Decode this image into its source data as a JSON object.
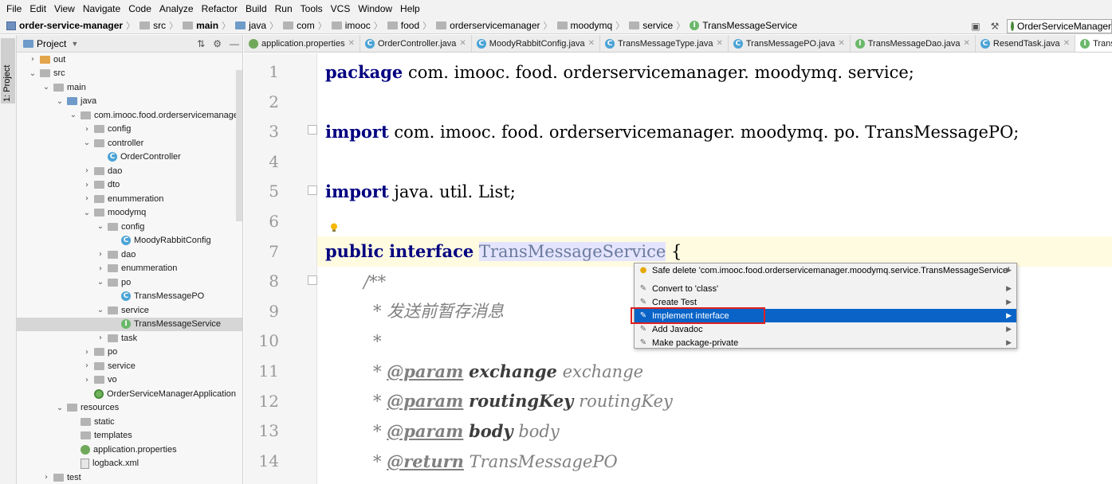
{
  "menu": [
    "File",
    "Edit",
    "View",
    "Navigate",
    "Code",
    "Analyze",
    "Refactor",
    "Build",
    "Run",
    "Tools",
    "VCS",
    "Window",
    "Help"
  ],
  "breadcrumb": [
    {
      "label": "order-service-manager",
      "icon": "module-icon",
      "bold": true
    },
    {
      "label": "src",
      "icon": "folder-icon",
      "bold": false
    },
    {
      "label": "main",
      "icon": "folder-icon",
      "bold": true
    },
    {
      "label": "java",
      "icon": "folder-icon",
      "bold": false
    },
    {
      "label": "com",
      "icon": "folder-icon",
      "bold": false
    },
    {
      "label": "imooc",
      "icon": "folder-icon",
      "bold": false
    },
    {
      "label": "food",
      "icon": "folder-icon",
      "bold": false
    },
    {
      "label": "orderservicemanager",
      "icon": "folder-icon",
      "bold": false
    },
    {
      "label": "moodymq",
      "icon": "folder-icon",
      "bold": false
    },
    {
      "label": "service",
      "icon": "folder-icon",
      "bold": false
    },
    {
      "label": "TransMessageService",
      "icon": "interface-icon",
      "bold": false
    }
  ],
  "run_config": "OrderServiceManagerA",
  "left_strip": {
    "project_tab": "1: Project"
  },
  "project_panel": {
    "title": "Project",
    "tree": [
      {
        "label": "out",
        "depth": 0,
        "arrow": "right",
        "icon": "folder-orange"
      },
      {
        "label": "src",
        "depth": 0,
        "arrow": "down",
        "icon": "folder"
      },
      {
        "label": "main",
        "depth": 1,
        "arrow": "down",
        "icon": "folder"
      },
      {
        "label": "java",
        "depth": 2,
        "arrow": "down",
        "icon": "folder-blue"
      },
      {
        "label": "com.imooc.food.orderservicemanager",
        "depth": 3,
        "arrow": "down",
        "icon": "folder"
      },
      {
        "label": "config",
        "depth": 4,
        "arrow": "right",
        "icon": "folder"
      },
      {
        "label": "controller",
        "depth": 4,
        "arrow": "down",
        "icon": "folder"
      },
      {
        "label": "OrderController",
        "depth": 5,
        "arrow": "none",
        "icon": "class"
      },
      {
        "label": "dao",
        "depth": 4,
        "arrow": "right",
        "icon": "folder"
      },
      {
        "label": "dto",
        "depth": 4,
        "arrow": "right",
        "icon": "folder"
      },
      {
        "label": "enummeration",
        "depth": 4,
        "arrow": "right",
        "icon": "folder"
      },
      {
        "label": "moodymq",
        "depth": 4,
        "arrow": "down",
        "icon": "folder"
      },
      {
        "label": "config",
        "depth": 5,
        "arrow": "down",
        "icon": "folder"
      },
      {
        "label": "MoodyRabbitConfig",
        "depth": 6,
        "arrow": "none",
        "icon": "class"
      },
      {
        "label": "dao",
        "depth": 5,
        "arrow": "right",
        "icon": "folder"
      },
      {
        "label": "enummeration",
        "depth": 5,
        "arrow": "right",
        "icon": "folder"
      },
      {
        "label": "po",
        "depth": 5,
        "arrow": "down",
        "icon": "folder"
      },
      {
        "label": "TransMessagePO",
        "depth": 6,
        "arrow": "none",
        "icon": "class"
      },
      {
        "label": "service",
        "depth": 5,
        "arrow": "down",
        "icon": "folder"
      },
      {
        "label": "TransMessageService",
        "depth": 6,
        "arrow": "none",
        "icon": "interface",
        "selected": true
      },
      {
        "label": "task",
        "depth": 5,
        "arrow": "right",
        "icon": "folder"
      },
      {
        "label": "po",
        "depth": 4,
        "arrow": "right",
        "icon": "folder"
      },
      {
        "label": "service",
        "depth": 4,
        "arrow": "right",
        "icon": "folder"
      },
      {
        "label": "vo",
        "depth": 4,
        "arrow": "right",
        "icon": "folder"
      },
      {
        "label": "OrderServiceManagerApplication",
        "depth": 4,
        "arrow": "none",
        "icon": "spring"
      },
      {
        "label": "resources",
        "depth": 2,
        "arrow": "down",
        "icon": "folder"
      },
      {
        "label": "static",
        "depth": 3,
        "arrow": "none",
        "icon": "folder"
      },
      {
        "label": "templates",
        "depth": 3,
        "arrow": "none",
        "icon": "folder"
      },
      {
        "label": "application.properties",
        "depth": 3,
        "arrow": "none",
        "icon": "leaf"
      },
      {
        "label": "logback.xml",
        "depth": 3,
        "arrow": "none",
        "icon": "file"
      },
      {
        "label": "test",
        "depth": 1,
        "arrow": "right",
        "icon": "folder"
      }
    ]
  },
  "editor_tabs": [
    {
      "label": "application.properties",
      "icon": "leaf"
    },
    {
      "label": "OrderController.java",
      "icon": "class"
    },
    {
      "label": "MoodyRabbitConfig.java",
      "icon": "class"
    },
    {
      "label": "TransMessageType.java",
      "icon": "class"
    },
    {
      "label": "TransMessagePO.java",
      "icon": "class"
    },
    {
      "label": "TransMessageDao.java",
      "icon": "interface"
    },
    {
      "label": "ResendTask.java",
      "icon": "class"
    },
    {
      "label": "Trans",
      "icon": "interface",
      "active": true
    }
  ],
  "line_numbers": [
    "1",
    "2",
    "3",
    "4",
    "5",
    "6",
    "7",
    "8",
    "9",
    "10",
    "11",
    "12",
    "13",
    "14"
  ],
  "code": {
    "l1_kw": "package",
    "l1_rest": " com. imooc. food. orderservicemanager. moodymq. service;",
    "l3_kw": "import",
    "l3_rest": " com. imooc. food. orderservicemanager. moodymq. po. TransMessagePO;",
    "l5_kw": "import",
    "l5_rest": " java. util. List;",
    "l7_kw1": "public",
    "l7_kw2": "interface",
    "l7_name": "TransMessageService",
    "l7_brace": " {",
    "l8": "/**",
    "l9": "* 发送前暂存消息",
    "l10": "*",
    "l11_star": "* ",
    "l11_tag": "@param",
    "l11_name": "exchange",
    "l11_desc": "exchange",
    "l12_star": "* ",
    "l12_tag": "@param",
    "l12_name": "routingKey",
    "l12_desc": "routingKey",
    "l13_star": "* ",
    "l13_tag": "@param",
    "l13_name": "body",
    "l13_desc": "body",
    "l14_star": "* ",
    "l14_tag": "@return",
    "l14_desc": "TransMessagePO"
  },
  "intention_popup": {
    "items": [
      {
        "label": "Safe delete 'com.imooc.food.orderservicemanager.moodymq.service.TransMessageService'",
        "icon": "bulb-icon"
      },
      {
        "label": "Convert to 'class'",
        "icon": "pencil-icon"
      },
      {
        "label": "Create Test",
        "icon": "pencil-icon"
      },
      {
        "label": "Implement interface",
        "icon": "pencil-icon",
        "selected": true
      },
      {
        "label": "Add Javadoc",
        "icon": "pencil-icon"
      },
      {
        "label": "Make package-private",
        "icon": "pencil-icon"
      }
    ]
  },
  "colors": {
    "keyword": "#000080",
    "selection": "#0a64c8",
    "highlight_box": "#e02020",
    "caret_line": "#fffbe0"
  }
}
